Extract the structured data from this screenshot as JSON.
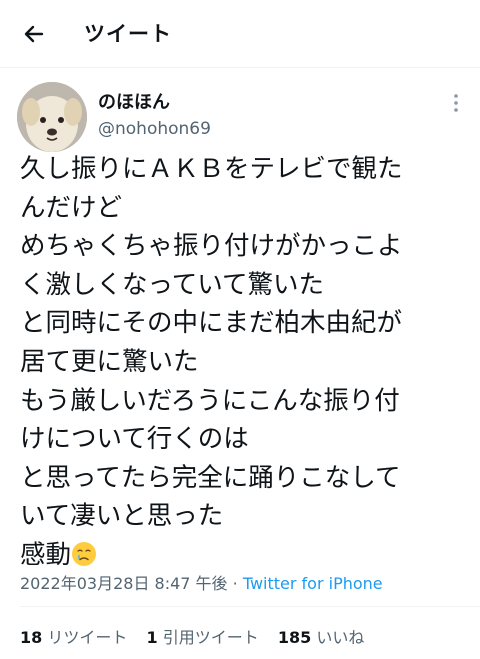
{
  "header": {
    "title": "ツイート",
    "back_icon": "arrow-left-icon"
  },
  "tweet": {
    "author_name": "のほほん",
    "author_handle": "@nohohon69",
    "lines": [
      "久し振りにＡＫＢをテレビで観たんだけど",
      "めちゃくちゃ振り付けがかっこよく激しくなっていて驚いた",
      "と同時にその中にまだ柏木由紀が居て更に驚いた",
      "もう厳しいだろうにこんな振り付けについて行くのは",
      "と思ってたら完全に踊りこなしていて凄いと思った",
      "感動"
    ],
    "display_lines": [
      "久し振りにＡＫＢをテレビで観た",
      "んだけど",
      "めちゃくちゃ振り付けがかっこよ",
      "く激しくなっていて驚いた",
      "と同時にその中にまだ柏木由紀が",
      "居て更に驚いた",
      "もう厳しいだろうにこんな振り付",
      "けについて行くのは",
      "と思ってたら完全に踊りこなして",
      "いて凄いと思った",
      "感動"
    ],
    "emoji": "crying-face-emoji",
    "timestamp": "2022年03月28日 8:47 午後",
    "separator": "·",
    "source": "Twitter for iPhone"
  },
  "stats": {
    "retweets_count": "18",
    "retweets_label": "リツイート",
    "quotes_count": "1",
    "quotes_label": "引用ツイート",
    "likes_count": "185",
    "likes_label": "いいね"
  },
  "colors": {
    "text": "#0f1419",
    "secondary": "#536471",
    "link": "#1d9bf0",
    "divider": "#eff3f4"
  }
}
